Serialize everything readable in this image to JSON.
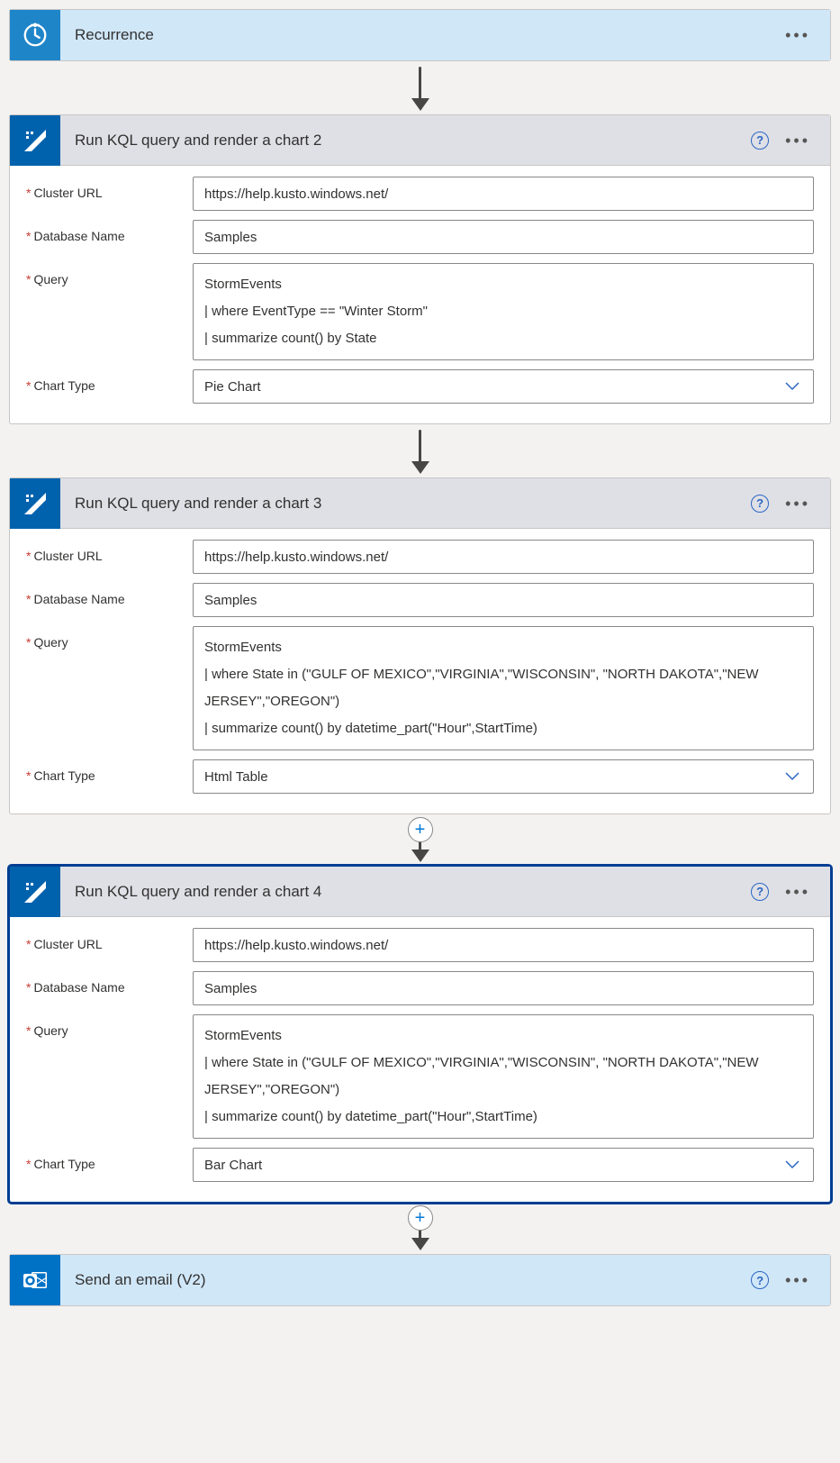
{
  "recurrence": {
    "title": "Recurrence"
  },
  "labels": {
    "cluster_url": "Cluster URL",
    "database_name": "Database Name",
    "query": "Query",
    "chart_type": "Chart Type"
  },
  "kql2": {
    "title": "Run KQL query and render a chart 2",
    "cluster_url": "https://help.kusto.windows.net/",
    "database_name": "Samples",
    "query": "StormEvents\n| where EventType == \"Winter Storm\"\n| summarize count() by State",
    "chart_type": "Pie Chart"
  },
  "kql3": {
    "title": "Run KQL query and render a chart 3",
    "cluster_url": "https://help.kusto.windows.net/",
    "database_name": "Samples",
    "query": "StormEvents\n| where State in (\"GULF OF MEXICO\",\"VIRGINIA\",\"WISCONSIN\", \"NORTH DAKOTA\",\"NEW JERSEY\",\"OREGON\")\n| summarize count() by datetime_part(\"Hour\",StartTime)",
    "chart_type": "Html Table"
  },
  "kql4": {
    "title": "Run KQL query and render a chart 4",
    "cluster_url": "https://help.kusto.windows.net/",
    "database_name": "Samples",
    "query": "StormEvents\n| where State in (\"GULF OF MEXICO\",\"VIRGINIA\",\"WISCONSIN\", \"NORTH DAKOTA\",\"NEW JERSEY\",\"OREGON\")\n| summarize count() by datetime_part(\"Hour\",StartTime)",
    "chart_type": "Bar Chart"
  },
  "email": {
    "title": "Send an email (V2)"
  }
}
